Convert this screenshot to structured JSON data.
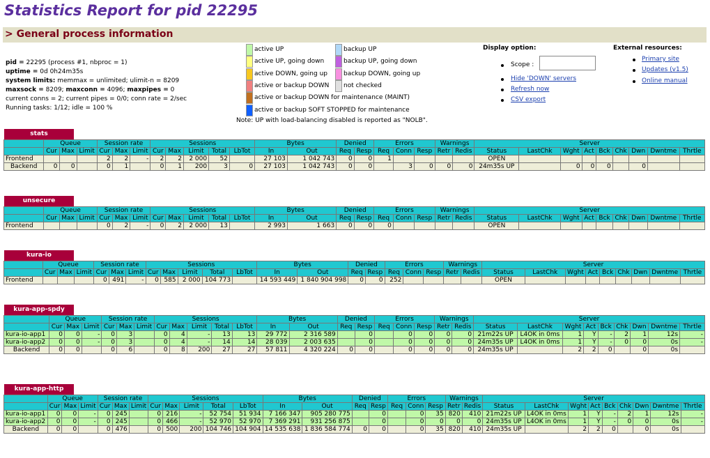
{
  "title": "Statistics Report for pid 22295",
  "section": "> General process information",
  "info": {
    "pid_label": "pid =",
    "pid_val": " 22295 (process #1, nbproc = 1)",
    "uptime_label": "uptime =",
    "uptime_val": " 0d 0h24m35s",
    "syslim_label": "system limits:",
    "syslim_val": " memmax = unlimited; ulimit-n = 8209",
    "maxsock_label": "maxsock =",
    "maxsock_val": " 8209; ",
    "maxconn_label": "maxconn =",
    "maxconn_val": " 4096; ",
    "maxpipes_label": "maxpipes =",
    "maxpipes_val": " 0",
    "conns": "current conns = 2; current pipes = 0/0; conn rate = 2/sec",
    "tasks": "Running tasks: 1/12; idle = 100 %"
  },
  "legend_left": [
    {
      "label": "active UP",
      "color": "#c0f8a8"
    },
    {
      "label": "active UP, going down",
      "color": "#ffff80"
    },
    {
      "label": "active DOWN, going up",
      "color": "#f8c820"
    },
    {
      "label": "active or backup DOWN",
      "color": "#f08080"
    },
    {
      "label": "active or backup DOWN for maintenance (MAINT)",
      "color": "#c07020"
    },
    {
      "label": "active or backup SOFT STOPPED for maintenance",
      "color": "#1060ff"
    }
  ],
  "legend_right": [
    {
      "label": "backup UP",
      "color": "#b0d8f8"
    },
    {
      "label": "backup UP, going down",
      "color": "#c060e0"
    },
    {
      "label": "backup DOWN, going up",
      "color": "#f890e0"
    },
    {
      "label": "not checked",
      "color": "#e0e0e0"
    }
  ],
  "note": "Note: UP with load-balancing disabled is reported as \"NOLB\".",
  "display": {
    "title": "Display option:",
    "scope": "Scope :",
    "hide": "Hide 'DOWN' servers",
    "refresh": "Refresh now",
    "csv": "CSV export"
  },
  "external": {
    "title": "External resources:",
    "primary": "Primary site",
    "updates": "Updates (v1.5)",
    "manual": "Online manual"
  },
  "hdr1": [
    "",
    "Queue",
    "Session rate",
    "Sessions",
    "Bytes",
    "Denied",
    "Errors",
    "Warnings",
    "Server"
  ],
  "hdr2": [
    "",
    "Cur",
    "Max",
    "Limit",
    "Cur",
    "Max",
    "Limit",
    "Cur",
    "Max",
    "Limit",
    "Total",
    "LbTot",
    "In",
    "Out",
    "Req",
    "Resp",
    "Req",
    "Conn",
    "Resp",
    "Retr",
    "Redis",
    "Status",
    "LastChk",
    "Wght",
    "Act",
    "Bck",
    "Chk",
    "Dwn",
    "Dwntme",
    "Thrtle"
  ],
  "proxies": [
    {
      "name": "stats",
      "rows": [
        {
          "type": "fe",
          "c": [
            "Frontend",
            "",
            "",
            "",
            "2",
            "2",
            "-",
            "2",
            "2",
            "2 000",
            "52",
            "",
            "27 103",
            "1 042 743",
            "0",
            "0",
            "1",
            "",
            "",
            "",
            "",
            "OPEN",
            "",
            "",
            "",
            "",
            "",
            "",
            "",
            ""
          ]
        },
        {
          "type": "be",
          "c": [
            "Backend",
            "0",
            "0",
            "",
            "0",
            "1",
            "",
            "0",
            "1",
            "200",
            "3",
            "0",
            "27 103",
            "1 042 743",
            "0",
            "0",
            "",
            "3",
            "0",
            "0",
            "0",
            "24m35s UP",
            "",
            "0",
            "0",
            "0",
            "",
            "0",
            "",
            ""
          ]
        }
      ]
    },
    {
      "name": "unsecure",
      "rows": [
        {
          "type": "fe",
          "c": [
            "Frontend",
            "",
            "",
            "",
            "0",
            "2",
            "-",
            "0",
            "2",
            "2 000",
            "13",
            "",
            "2 993",
            "1 663",
            "0",
            "0",
            "0",
            "",
            "",
            "",
            "",
            "OPEN",
            "",
            "",
            "",
            "",
            "",
            "",
            "",
            ""
          ]
        }
      ]
    },
    {
      "name": "kura-io",
      "rows": [
        {
          "type": "fe",
          "c": [
            "Frontend",
            "",
            "",
            "",
            "0",
            "491",
            "-",
            "0",
            "585",
            "2 000",
            "104 773",
            "",
            "14 593 449",
            "1 840 904 998",
            "0",
            "0",
            "252",
            "",
            "",
            "",
            "",
            "OPEN",
            "",
            "",
            "",
            "",
            "",
            "",
            "",
            ""
          ]
        }
      ]
    },
    {
      "name": "kura-app-spdy",
      "rows": [
        {
          "type": "up",
          "c": [
            "kura-io-app1",
            "0",
            "0",
            "-",
            "0",
            "3",
            "",
            "0",
            "4",
            "-",
            "13",
            "13",
            "29 772",
            "2 316 589",
            "",
            "0",
            "",
            "0",
            "0",
            "0",
            "0",
            "21m22s UP",
            "L4OK in 0ms",
            "1",
            "Y",
            "-",
            "2",
            "1",
            "12s",
            "-"
          ]
        },
        {
          "type": "up",
          "c": [
            "kura-io-app2",
            "0",
            "0",
            "-",
            "0",
            "3",
            "",
            "0",
            "4",
            "-",
            "14",
            "14",
            "28 039",
            "2 003 635",
            "",
            "0",
            "",
            "0",
            "0",
            "0",
            "0",
            "24m35s UP",
            "L4OK in 0ms",
            "1",
            "Y",
            "-",
            "0",
            "0",
            "0s",
            "-"
          ]
        },
        {
          "type": "be",
          "c": [
            "Backend",
            "0",
            "0",
            "",
            "0",
            "6",
            "",
            "0",
            "8",
            "200",
            "27",
            "27",
            "57 811",
            "4 320 224",
            "0",
            "0",
            "",
            "0",
            "0",
            "0",
            "0",
            "24m35s UP",
            "",
            "2",
            "2",
            "0",
            "",
            "0",
            "0s",
            ""
          ]
        }
      ]
    },
    {
      "name": "kura-app-http",
      "rows": [
        {
          "type": "up",
          "c": [
            "kura-io-app1",
            "0",
            "0",
            "-",
            "0",
            "245",
            "",
            "0",
            "216",
            "-",
            "52 754",
            "51 934",
            "7 166 347",
            "905 280 775",
            "",
            "0",
            "",
            "0",
            "35",
            "820",
            "410",
            "21m22s UP",
            "L4OK in 0ms",
            "1",
            "Y",
            "-",
            "2",
            "1",
            "12s",
            "-"
          ]
        },
        {
          "type": "up",
          "c": [
            "kura-io-app2",
            "0",
            "0",
            "-",
            "0",
            "245",
            "",
            "0",
            "466",
            "-",
            "52 970",
            "52 970",
            "7 369 291",
            "931 256 875",
            "",
            "0",
            "",
            "0",
            "0",
            "0",
            "0",
            "24m35s UP",
            "L4OK in 0ms",
            "1",
            "Y",
            "-",
            "0",
            "0",
            "0s",
            "-"
          ]
        },
        {
          "type": "be",
          "c": [
            "Backend",
            "0",
            "0",
            "",
            "0",
            "476",
            "",
            "0",
            "500",
            "200",
            "104 746",
            "104 904",
            "14 535 638",
            "1 836 584 774",
            "0",
            "0",
            "",
            "0",
            "35",
            "820",
            "410",
            "24m35s UP",
            "",
            "2",
            "2",
            "0",
            "",
            "0",
            "0s",
            ""
          ]
        }
      ]
    }
  ]
}
